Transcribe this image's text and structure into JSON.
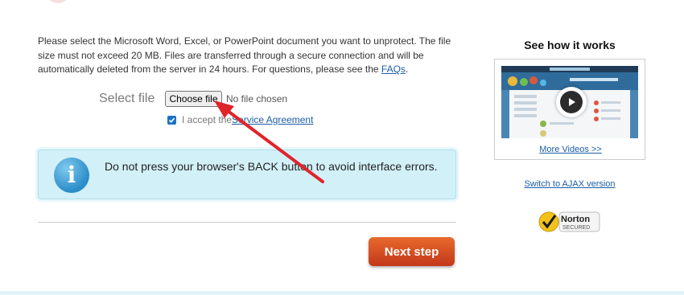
{
  "intro": {
    "text": "Please select the Microsoft Word, Excel, or PowerPoint document you want to unprotect. The file size must not exceed 20 MB. Files are transferred through a secure connection and will be automatically deleted from the server in 24 hours. For questions, please see the ",
    "faq_link": "FAQs",
    "tail": "."
  },
  "upload": {
    "label": "Select file",
    "button_label": "Choose file",
    "status": "No file chosen"
  },
  "agreement": {
    "checked": true,
    "prefix": "I accept the ",
    "link": "Service Agreement"
  },
  "notice": {
    "icon": "info-icon",
    "text": "Do not press your browser's BACK button to avoid interface errors."
  },
  "actions": {
    "next_label": "Next step"
  },
  "sidebar": {
    "title": "See how it works",
    "more_videos": "More Videos >>",
    "ajax_link": "Switch to AJAX version",
    "norton": {
      "line1": "Norton",
      "line2": "SECURED"
    }
  },
  "colors": {
    "accent": "#1a5ea8",
    "next_button": "#d24c22",
    "notice_bg": "#d2f0f8",
    "annotation_arrow": "#e0242b"
  }
}
